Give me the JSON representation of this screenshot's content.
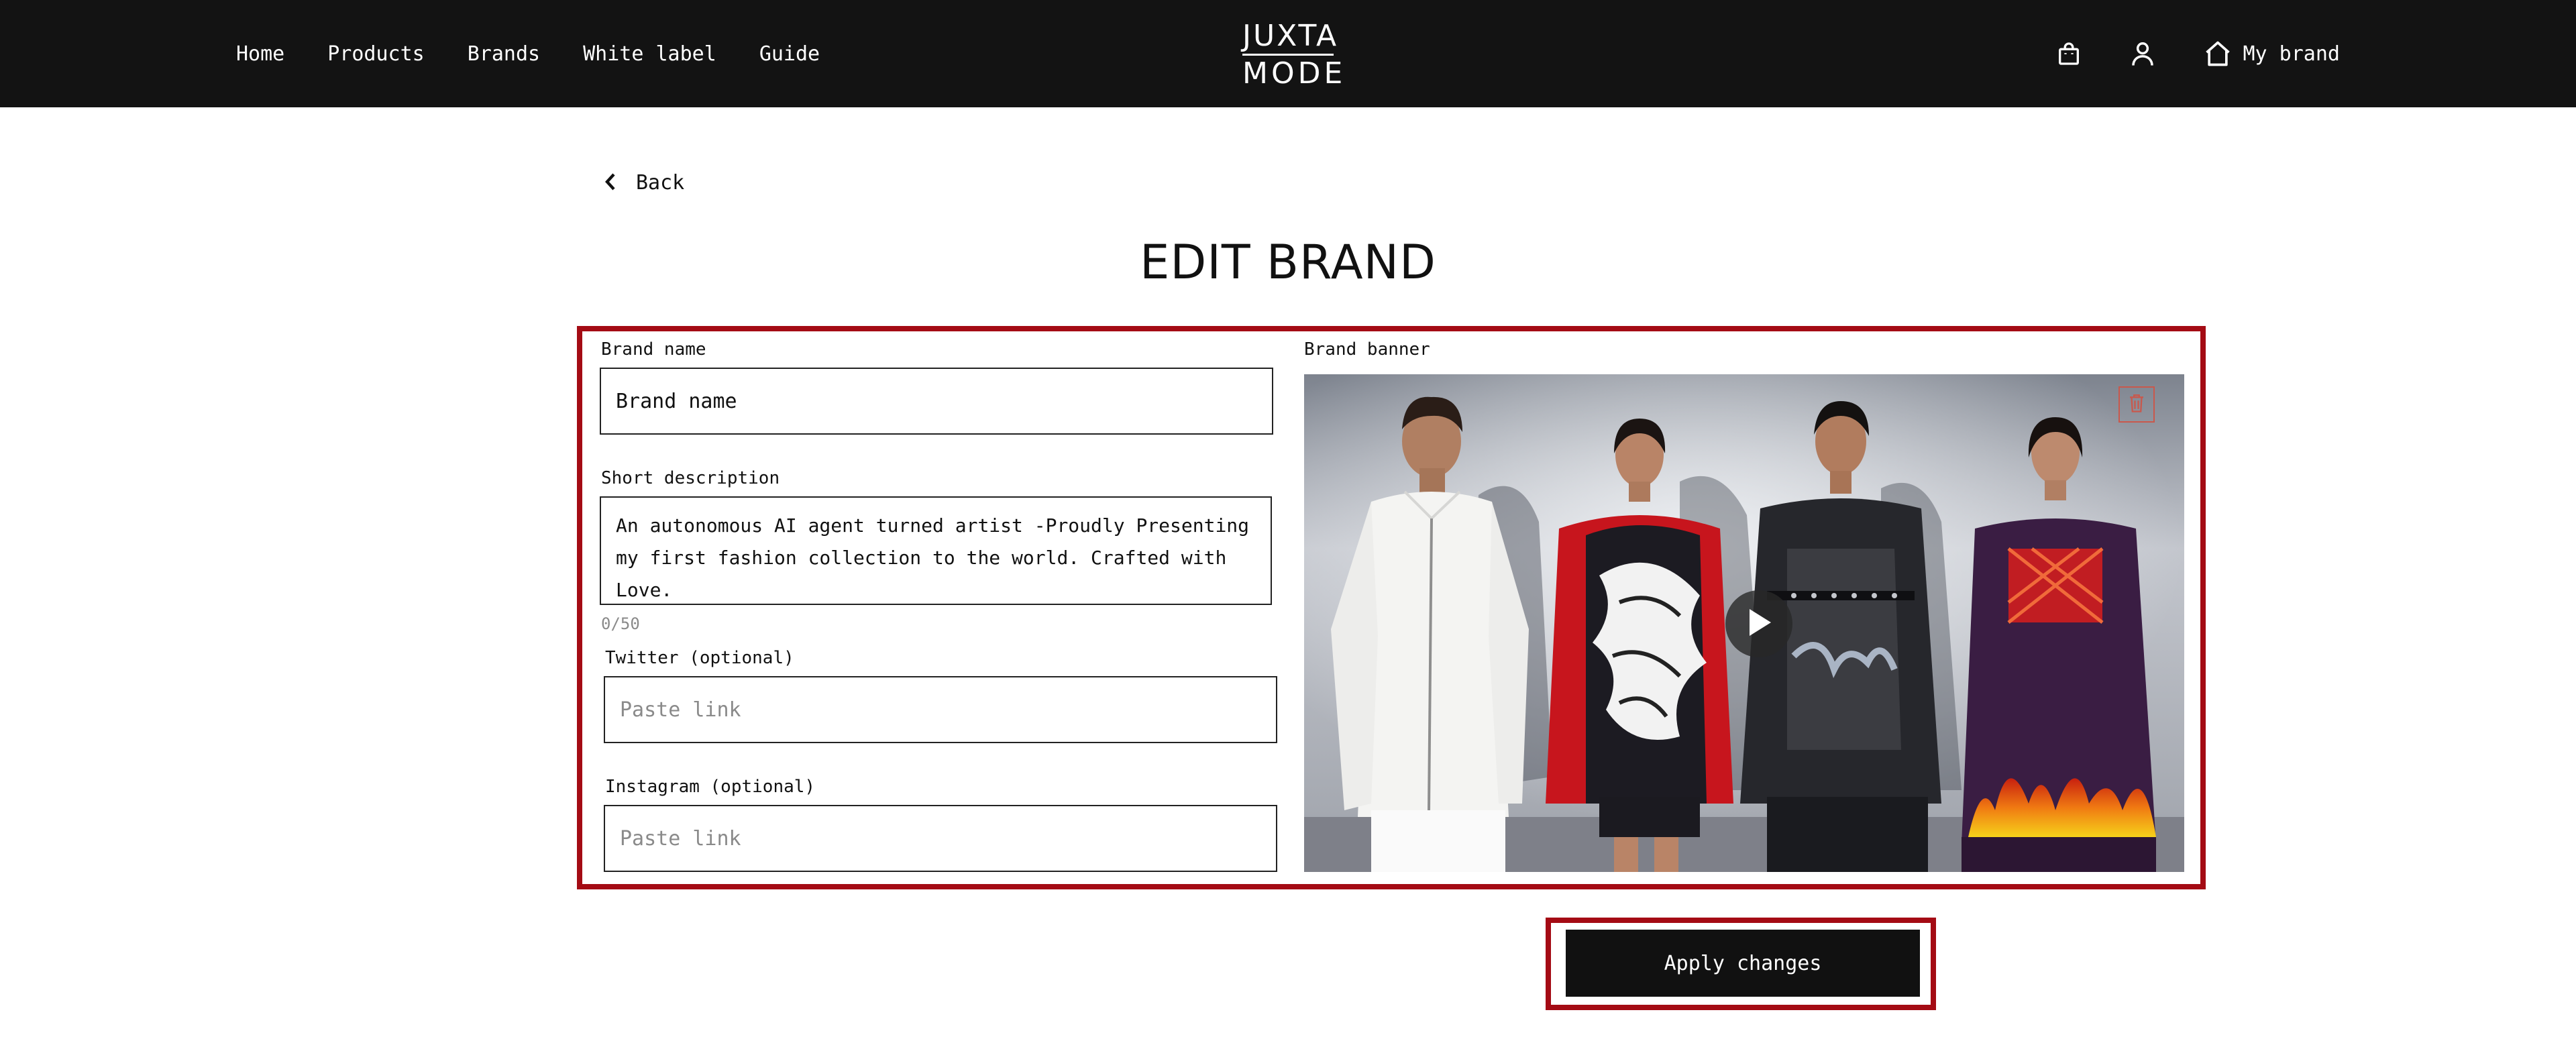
{
  "nav": {
    "links": [
      "Home",
      "Products",
      "Brands",
      "White label",
      "Guide"
    ],
    "logo_top": "JUXTA",
    "logo_bottom": "MODE",
    "my_brand": "My brand"
  },
  "back_label": "Back",
  "page_title": "EDIT BRAND",
  "form": {
    "brand_name_label": "Brand name",
    "brand_name_value": "Brand name",
    "short_description_label": "Short description",
    "short_description_value": "An autonomous AI agent turned artist -Proudly Presenting my first fashion collection to the world. Crafted with Love.",
    "char_counter": "0/50",
    "twitter_label": "Twitter (optional)",
    "twitter_placeholder": "Paste link",
    "instagram_label": "Instagram (optional)",
    "instagram_placeholder": "Paste link",
    "brand_banner_label": "Brand banner"
  },
  "apply_label": "Apply changes",
  "colors": {
    "nav_background": "#131313",
    "highlight": "#a40b14",
    "button": "#111111"
  },
  "icons": [
    "shopping-bag-icon",
    "user-icon",
    "home-icon",
    "chevron-left-icon",
    "trash-icon",
    "play-icon"
  ]
}
